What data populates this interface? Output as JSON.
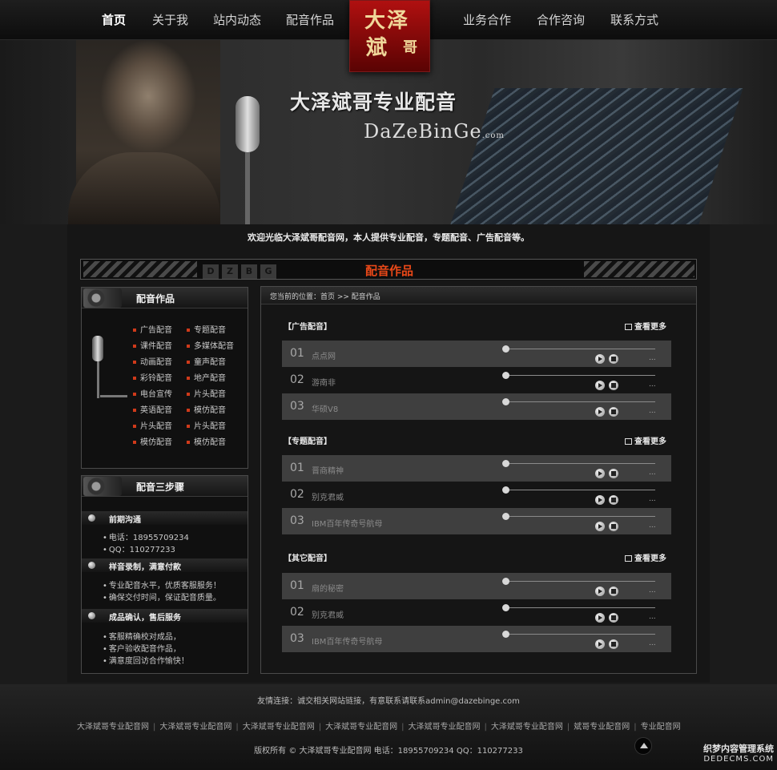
{
  "nav": {
    "items_left": [
      "首页",
      "关于我",
      "站内动态",
      "配音作品"
    ],
    "items_right": [
      "业务合作",
      "合作咨询",
      "联系方式"
    ],
    "active": "首页",
    "logo": {
      "line1": "大泽",
      "line2": "斌",
      "line3": "哥"
    }
  },
  "banner": {
    "headline": "大泽斌哥专业配音",
    "brand_en": "DaZeBinGe",
    "brand_suffix": ".com"
  },
  "welcome": "欢迎光临大泽斌哥配音网，本人提供专业配音，专题配音、广告配音等。",
  "section": {
    "title": "配音作品",
    "letters": [
      "D",
      "Z",
      "B",
      "G"
    ]
  },
  "sidebar": {
    "works": {
      "title": "配音作品",
      "categories": [
        [
          "广告配音",
          "专题配音"
        ],
        [
          "课件配音",
          "多媒体配音"
        ],
        [
          "动画配音",
          "童声配音"
        ],
        [
          "彩铃配音",
          "地产配音"
        ],
        [
          "电台宣传",
          "片头配音"
        ],
        [
          "英语配音",
          "模仿配音"
        ],
        [
          "片头配音",
          "片头配音"
        ],
        [
          "模仿配音",
          "模仿配音"
        ]
      ]
    },
    "steps": {
      "title": "配音三步骤",
      "items": [
        {
          "title": "前期沟通",
          "lines": [
            "电话：18955709234",
            "QQ：110277233"
          ]
        },
        {
          "title": "样音录制，满意付款",
          "lines": [
            "专业配音水平，优质客服服务！",
            "确保交付时间，保证配音质量。"
          ]
        },
        {
          "title": "成品确认，售后服务",
          "lines": [
            "客服精确校对成品，",
            "客户验收配音作品，",
            "满意度回访合作愉快！"
          ]
        }
      ]
    }
  },
  "main": {
    "breadcrumb": "您当前的位置：首页 >> 配音作品",
    "more_label": "查看更多",
    "groups": [
      {
        "title": "【广告配音】",
        "tracks": [
          {
            "num": "01",
            "name": "点点网"
          },
          {
            "num": "02",
            "name": "游南非"
          },
          {
            "num": "03",
            "name": "华硕V8"
          }
        ]
      },
      {
        "title": "【专题配音】",
        "tracks": [
          {
            "num": "01",
            "name": "晋商精神"
          },
          {
            "num": "02",
            "name": "别克君威"
          },
          {
            "num": "03",
            "name": "IBM百年传奇号航母"
          }
        ]
      },
      {
        "title": "【其它配音】",
        "tracks": [
          {
            "num": "01",
            "name": "扇的秘密"
          },
          {
            "num": "02",
            "name": "别克君威"
          },
          {
            "num": "03",
            "name": "IBM百年传奇号航母"
          }
        ]
      }
    ],
    "track_more": "..."
  },
  "footer": {
    "friend_links": "友情连接：诚交相关网站链接，有意联系请联系admin@dazebinge.com",
    "links": [
      "大泽斌哥专业配音网",
      "大泽斌哥专业配音网",
      "大泽斌哥专业配音网",
      "大泽斌哥专业配音网",
      "大泽斌哥专业配音网",
      "大泽斌哥专业配音网",
      "斌哥专业配音网",
      "专业配音网"
    ],
    "copyright": "版权所有 © 大泽斌哥专业配音网 电话：18955709234   QQ：110277233",
    "watermark": {
      "line1": "织梦内容管理系统",
      "line2": "DEDECMS.COM"
    }
  }
}
